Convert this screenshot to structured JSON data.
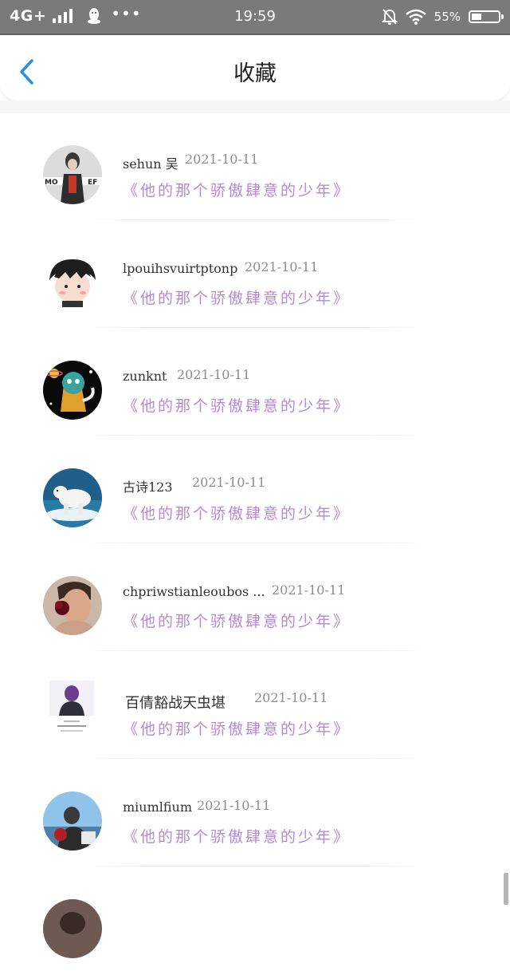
{
  "status_bar": {
    "network": "4G+",
    "time": "19:59",
    "battery": "55%"
  },
  "header": {
    "title": "收藏"
  },
  "favorites": [
    {
      "name": "sehun 吴",
      "date": "2021-10-11",
      "quote": "《他的那个骄傲肆意的少年》"
    },
    {
      "name": "lpouihsvuirtptonp",
      "date": "2021-10-11",
      "quote": "《他的那个骄傲肆意的少年》"
    },
    {
      "name": "zunknt",
      "date": "2021-10-11",
      "quote": "《他的那个骄傲肆意的少年》"
    },
    {
      "name": "古诗123",
      "date": "2021-10-11",
      "quote": "《他的那个骄傲肆意的少年》"
    },
    {
      "name": "chpriwstianleoubos ...",
      "date": "2021-10-11",
      "quote": "《他的那个骄傲肆意的少年》"
    },
    {
      "name": "百倩豁战天虫堪",
      "date": "2021-10-11",
      "quote": "《他的那个骄傲肆意的少年》"
    },
    {
      "name": "miumlfium",
      "date": "2021-10-11",
      "quote": "《他的那个骄傲肆意的少年》"
    }
  ],
  "colors": {
    "accent": "#2a8fe0",
    "quote": "#b48ad4",
    "status_bar": "#7a7a7a"
  }
}
